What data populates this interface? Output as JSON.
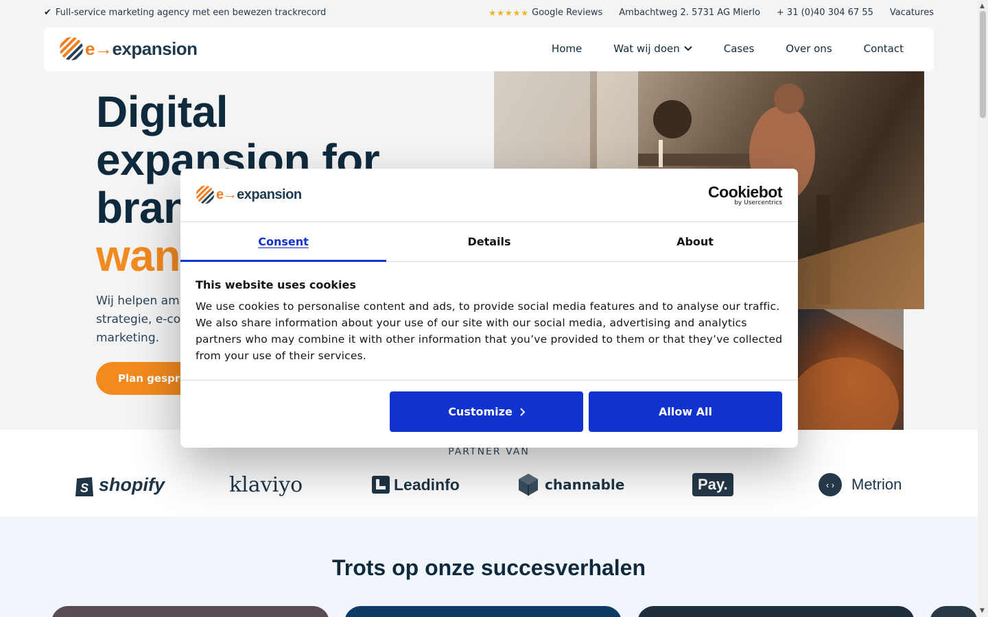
{
  "topbar": {
    "usp": "Full-service marketing agency met een bewezen trackrecord",
    "stars": "★★★★★",
    "reviews_label": "Google Reviews",
    "address": "Ambachtweg 2. 5731 AG Mierlo",
    "phone": "+ 31 (0)40 304 67 55",
    "vacatures": "Vacatures"
  },
  "brand": {
    "logo_prefix": "e→",
    "logo_name": "expansion"
  },
  "nav": {
    "items": [
      "Home",
      "Wat wij doen",
      "Cases",
      "Over ons",
      "Contact"
    ]
  },
  "hero": {
    "title_lines": [
      "Digital",
      "expansion for",
      "bran"
    ],
    "title_accent": "wan",
    "subtitle_lines": [
      "Wij helpen amb",
      "strategie, e-co",
      "marketing."
    ],
    "cta": "Plan gespre"
  },
  "partners": {
    "label": "PARTNER VAN",
    "logos": [
      "shopify",
      "klaviyo",
      "Leadinfo",
      "channable",
      "Pay.",
      "Metrion"
    ]
  },
  "success": {
    "title": "Trots op onze succesverhalen"
  },
  "cookie_dialog": {
    "brand_prefix": "e→",
    "brand_name": "expansion",
    "provider": "Cookiebot",
    "provider_sub": "by Usercentrics",
    "tabs": [
      "Consent",
      "Details",
      "About"
    ],
    "active_tab": "Consent",
    "heading": "This website uses cookies",
    "body": "We use cookies to personalise content and ads, to provide social media features and to analyse our traffic. We also share information about your use of our site with our social media, advertising and analytics partners who may combine it with other information that you’ve provided to them or that they’ve collected from your use of their services.",
    "customize_label": "Customize",
    "allow_all_label": "Allow All",
    "accent_color": "#1032cf"
  }
}
